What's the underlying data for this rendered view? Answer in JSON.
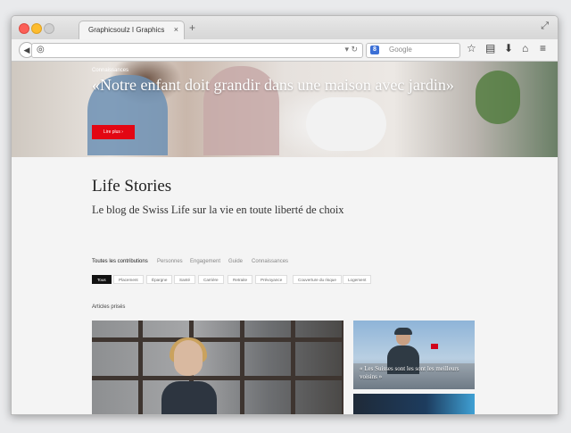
{
  "browser": {
    "tab_title": "Graphicsoulz I Graphics",
    "tab_close": "×",
    "new_tab": "+",
    "expand": "⤢",
    "search_placeholder": "Google",
    "search_engine_glyph": "8"
  },
  "hero": {
    "kicker": "Connaissances",
    "title": "«Notre enfant doit grandir dans une maison avec jardin»",
    "button_label": "Lire plus  ›"
  },
  "page": {
    "heading": "Life Stories",
    "subtitle": "Le blog de Swiss Life sur la vie en toute liberté de choix",
    "categories": [
      "Toutes les contributions",
      "Personnes",
      "Engagement",
      "Guide",
      "Connaissances"
    ],
    "tags": [
      "Tous",
      "Placement",
      "Épargne",
      "Santé",
      "Carrière",
      "Retraite",
      "Prévoyance",
      "Couverture du risque",
      "Logement"
    ],
    "section_label": "Articles prisés",
    "card_caption": "« Les Suisses sont les sont les meilleurs voisins »"
  },
  "colors": {
    "accent": "#e30613"
  }
}
